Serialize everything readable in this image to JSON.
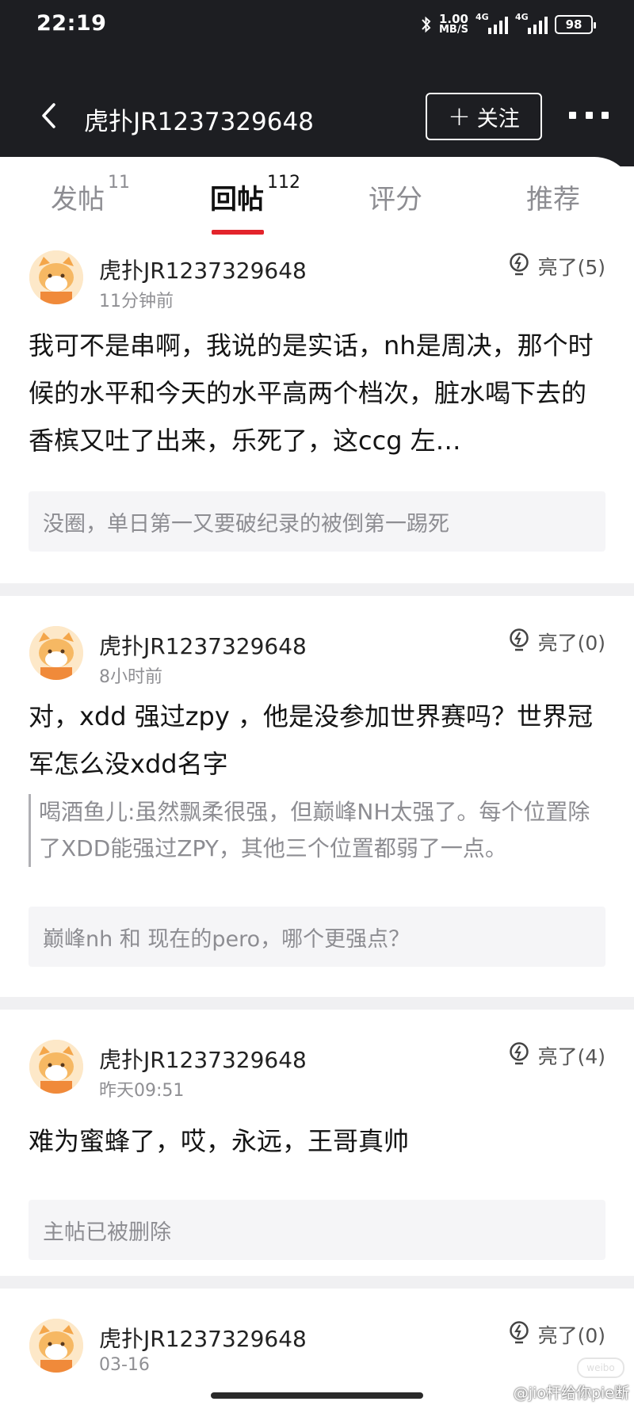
{
  "status_bar": {
    "time": "22:19",
    "speed_value": "1.00",
    "speed_unit": "MB/S",
    "net1": "4G",
    "net2": "4G",
    "battery": "98"
  },
  "nav": {
    "title": "虎扑JR1237329648",
    "follow_label": "关注"
  },
  "tabs": [
    {
      "label": "发帖",
      "count": "11"
    },
    {
      "label": "回帖",
      "count": "112"
    },
    {
      "label": "评分",
      "count": ""
    },
    {
      "label": "推荐",
      "count": ""
    }
  ],
  "active_tab": "回帖",
  "accent_color": "#e3242b",
  "posts": [
    {
      "username": "虎扑JR1237329648",
      "time": "11分钟前",
      "likes": "亮了(5)",
      "content": "我可不是串啊，我说的是实话，nh是周决，那个时候的水平和今天的水平高两个档次，脏水喝下去的香槟又吐了出来，乐死了，这ccg 左…",
      "quote": "",
      "ref": "没圈，单日第一又要破纪录的被倒第一踢死"
    },
    {
      "username": "虎扑JR1237329648",
      "time": "8小时前",
      "likes": "亮了(0)",
      "content": "对，xdd 强过zpy ，他是没参加世界赛吗？世界冠军怎么没xdd名字",
      "quote": "喝酒鱼儿:虽然飘柔很强，但巅峰NH太强了。每个位置除了XDD能强过ZPY，其他三个位置都弱了一点。",
      "ref": "巅峰nh 和 现在的pero，哪个更强点？"
    },
    {
      "username": "虎扑JR1237329648",
      "time": "昨天09:51",
      "likes": "亮了(4)",
      "content": "难为蜜蜂了，哎，永远，王哥真帅",
      "quote": "",
      "ref": "主帖已被删除"
    },
    {
      "username": "虎扑JR1237329648",
      "time": "03-16",
      "likes": "亮了(0)",
      "content": "",
      "quote": "",
      "ref": ""
    }
  ],
  "watermark": "@jio杆给你pie断"
}
